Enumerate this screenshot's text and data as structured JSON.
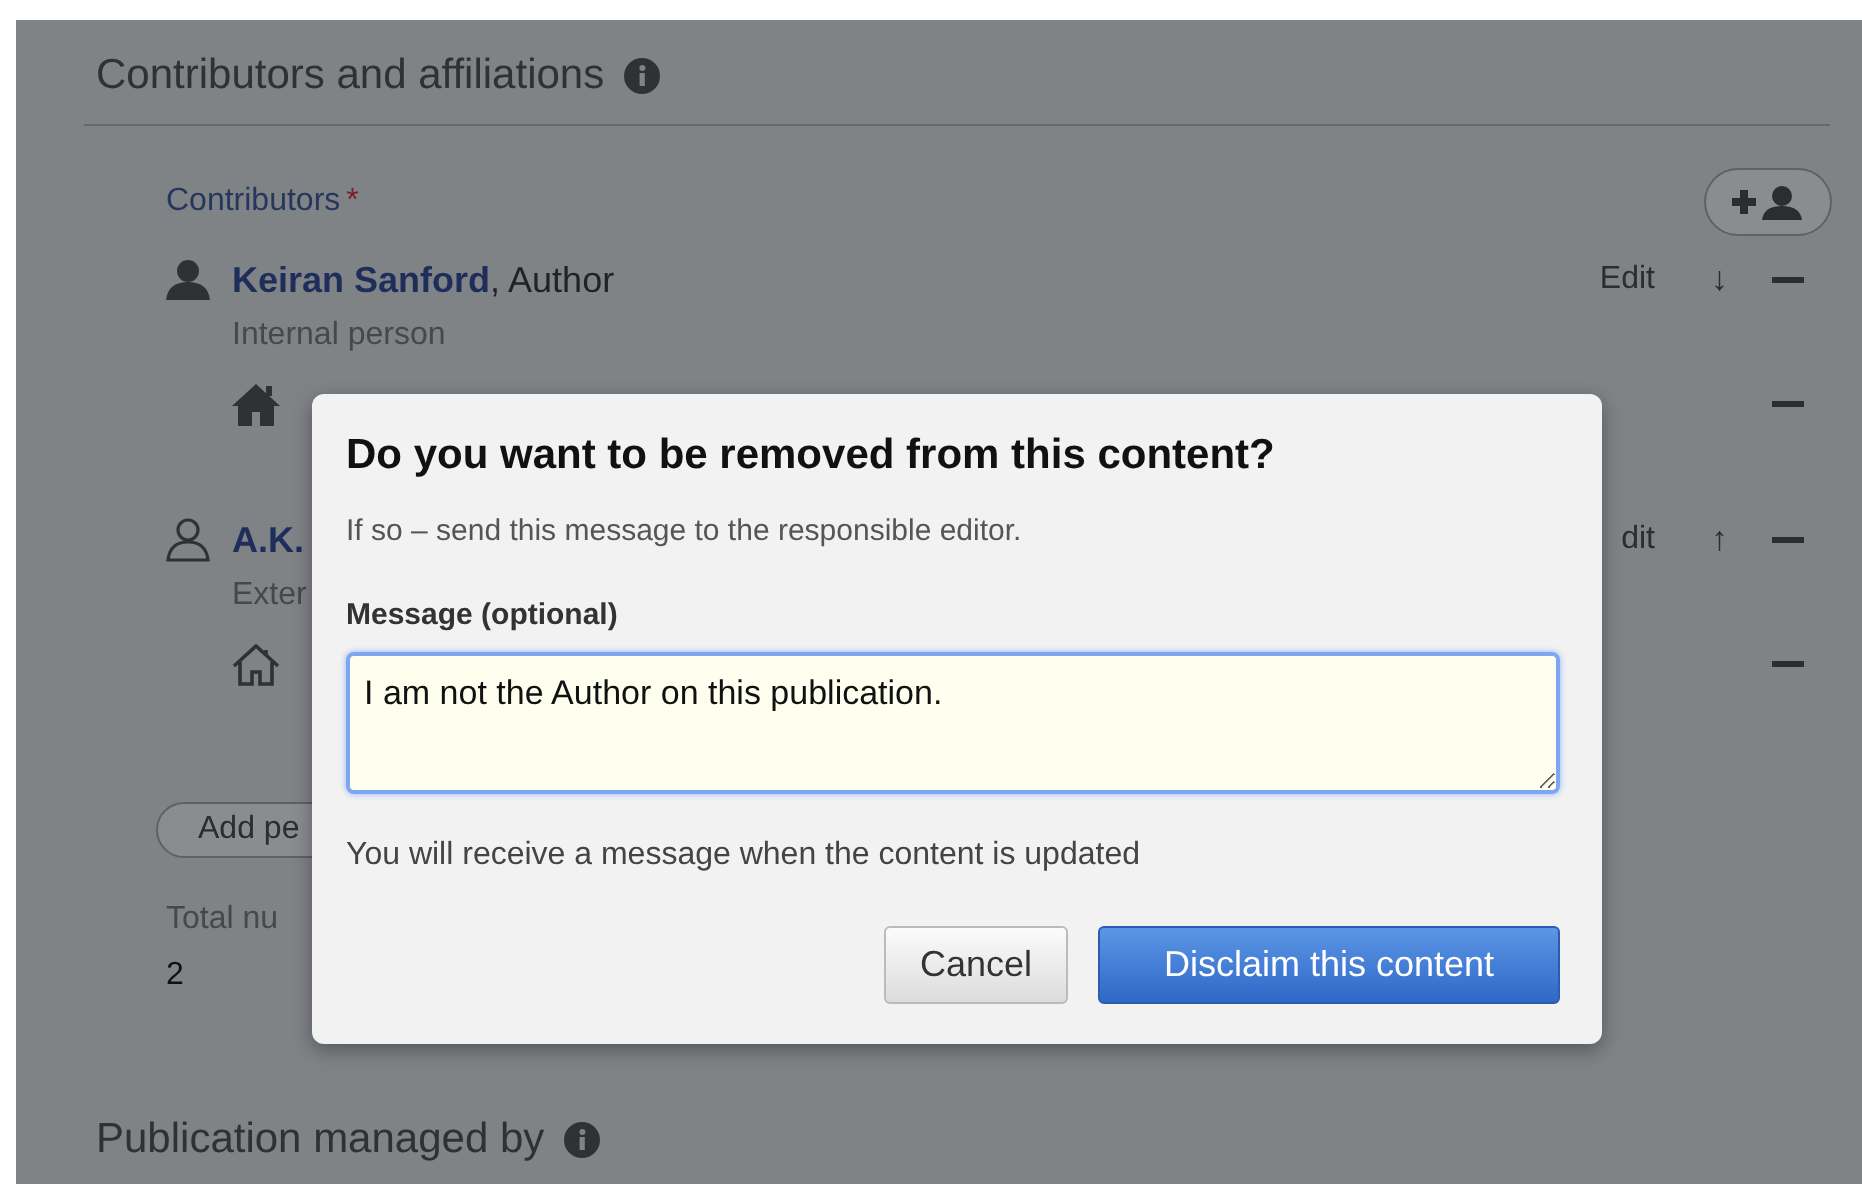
{
  "section": {
    "title": "Contributors and affiliations"
  },
  "contributors": {
    "label": "Contributors",
    "required_mark": "*"
  },
  "persons": [
    {
      "kind": "internal",
      "name": "Keiran Sanford",
      "role": ", Author",
      "type": "Internal person",
      "edit": "Edit",
      "move": "↓",
      "affiliations": [
        {
          "kind": "internal"
        }
      ]
    },
    {
      "kind": "external",
      "name": "A.K.",
      "type": "Exter",
      "edit": "dit",
      "move": "↑",
      "affiliations": [
        {
          "kind": "external"
        }
      ]
    }
  ],
  "add_person_button": "Add pe",
  "total": {
    "label": "Total nu",
    "value": "2"
  },
  "next_section": {
    "title": "Publication managed by"
  },
  "dialog": {
    "title": "Do you want to be removed from this content?",
    "subtitle": "If so – send this message to the responsible editor.",
    "field_label": "Message (optional)",
    "message": "I am not the Author on this publication.",
    "note": "You will receive a message when the content is updated",
    "buttons": [
      {
        "label": "Cancel",
        "kind": "secondary"
      },
      {
        "label": "Disclaim this content",
        "kind": "primary"
      }
    ]
  }
}
